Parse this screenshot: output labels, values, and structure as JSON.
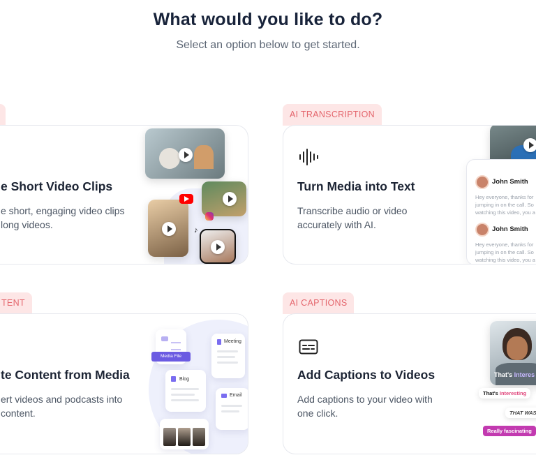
{
  "header": {
    "title": "What would you like to do?",
    "subtitle": "Select an option below to get started."
  },
  "cards": [
    {
      "tag": "",
      "title": "e Short Video Clips",
      "desc_line1": "e short, engaging video clips",
      "desc_line2": "long videos."
    },
    {
      "tag": "AI TRANSCRIPTION",
      "title": "Turn Media into Text",
      "desc_line1": "Transcribe audio or video",
      "desc_line2": "accurately with AI.",
      "chat": [
        {
          "name": "John Smith",
          "text": "Hey everyone, thanks for jumping in on the call. So watching this video, you a"
        },
        {
          "name": "John Smith",
          "text": "Hey everyone, thanks for jumping in on the call. So watching this video, you a"
        }
      ]
    },
    {
      "tag": "TENT",
      "title": "te Content from Media",
      "desc_line1": "ert videos and podcasts into",
      "desc_line2": "content.",
      "mini": {
        "media": "Media File",
        "meeting": "Meeting",
        "blog": "Blog",
        "email": "Email"
      }
    },
    {
      "tag": "AI CAPTIONS",
      "title": "Add Captions to Videos",
      "desc_line1": "Add captions to your video with",
      "desc_line2": "one click.",
      "captions": {
        "overlay_a": "That's ",
        "overlay_b": "Interes",
        "c1a": "That's ",
        "c1b": "Interesting",
        "c2": "THAT WAS AM",
        "c3": "Really fascinating"
      }
    }
  ],
  "colors": {
    "tag_bg": "#fde6e6",
    "tag_text": "#e4666d",
    "accent": "#6b5be2"
  }
}
